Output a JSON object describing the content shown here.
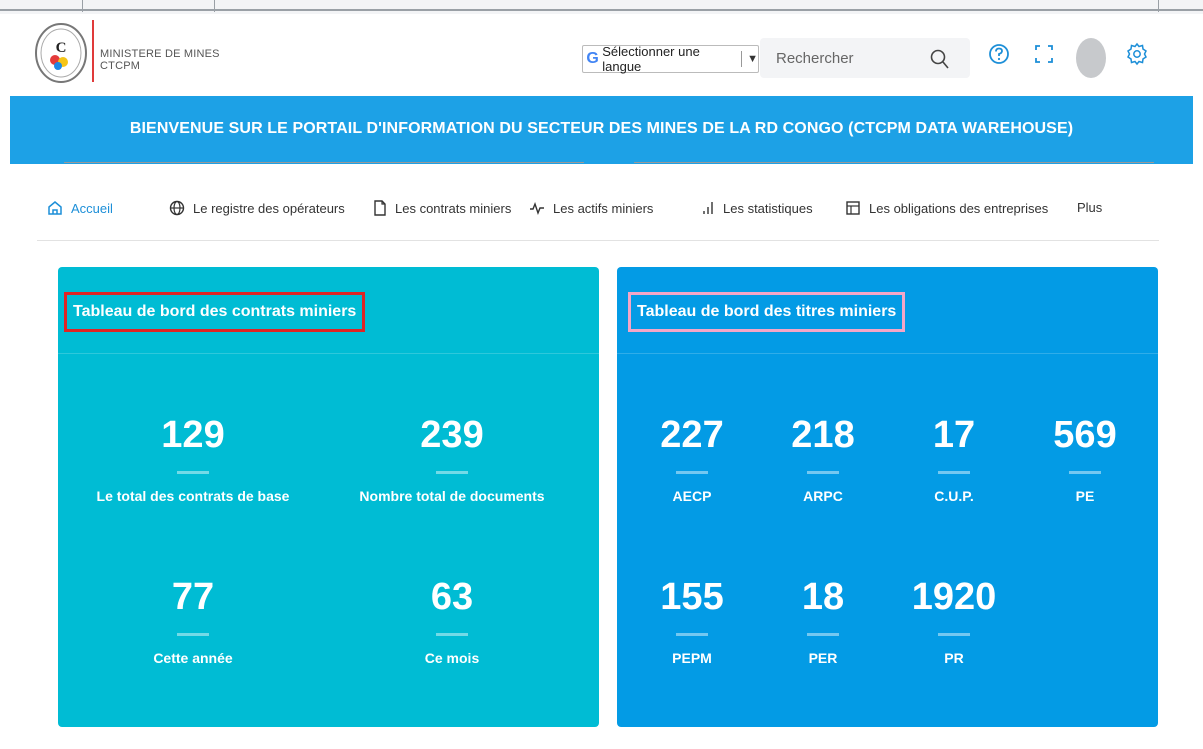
{
  "header": {
    "org_line1": "MINISTERE DE MINES",
    "org_line2": "CTCPM",
    "lang_select": "Sélectionner une langue",
    "search_placeholder": "Rechercher"
  },
  "banner": {
    "title": "BIENVENUE SUR LE PORTAIL D'INFORMATION DU SECTEUR DES MINES DE LA RD CONGO (CTCPM DATA WAREHOUSE)"
  },
  "nav": {
    "items": [
      {
        "label": "Accueil",
        "icon": "home-icon"
      },
      {
        "label": "Le registre des opérateurs",
        "icon": "globe-icon"
      },
      {
        "label": "Les contrats miniers",
        "icon": "document-icon"
      },
      {
        "label": "Les actifs miniers",
        "icon": "activity-icon"
      },
      {
        "label": "Les statistiques",
        "icon": "bar-chart-icon"
      },
      {
        "label": "Les obligations des entreprises",
        "icon": "layout-icon"
      },
      {
        "label": "Plus",
        "icon": ""
      }
    ]
  },
  "contracts_panel": {
    "title": "Tableau de bord des contrats miniers",
    "stats": [
      {
        "value": "129",
        "label": "Le total des contrats de base"
      },
      {
        "value": "239",
        "label": "Nombre total de documents"
      },
      {
        "value": "77",
        "label": "Cette année"
      },
      {
        "value": "63",
        "label": "Ce mois"
      }
    ]
  },
  "titles_panel": {
    "title": "Tableau de bord des titres miniers",
    "stats": [
      {
        "value": "227",
        "label": "AECP"
      },
      {
        "value": "218",
        "label": "ARPC"
      },
      {
        "value": "17",
        "label": "C.U.P."
      },
      {
        "value": "569",
        "label": "PE"
      },
      {
        "value": "155",
        "label": "PEPM"
      },
      {
        "value": "18",
        "label": "PER"
      },
      {
        "value": "1920",
        "label": "PR"
      }
    ]
  },
  "colors": {
    "banner": "#1da1e6",
    "contracts_panel": "#00bcd4",
    "titles_panel": "#039be5",
    "active_nav": "#1d8fd8",
    "highlight_red": "#e02424",
    "highlight_pink": "#f4a6c7"
  }
}
